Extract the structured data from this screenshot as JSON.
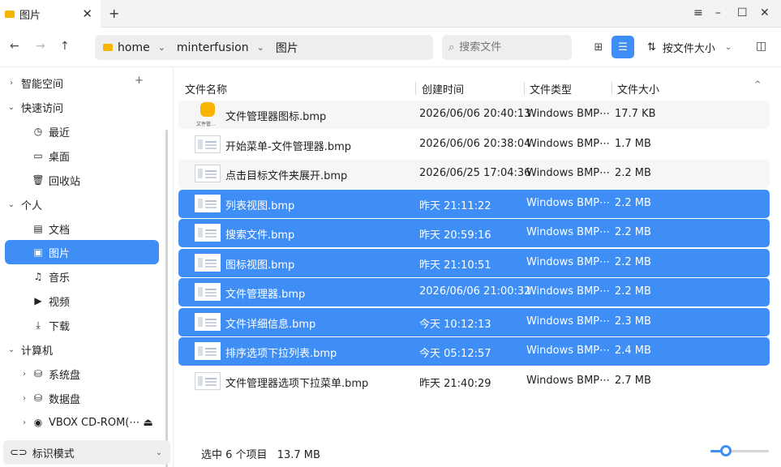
{
  "titlebar": {
    "tab_title": "图片",
    "tab_icon": "folder-image-icon",
    "new_tab": "+",
    "controls": {
      "menu": "≡",
      "minimize": "–",
      "maximize": "☐",
      "close": "✕"
    }
  },
  "toolbar": {
    "back": "←",
    "forward": "→",
    "up": "↑",
    "breadcrumbs": [
      "home",
      "minterfusion",
      "图片"
    ],
    "search_placeholder": "搜索文件",
    "sort_label": "按文件大小",
    "sort_icon": "⇅"
  },
  "sidebar": {
    "plus": "+",
    "items": [
      {
        "label": "智能空间",
        "arrow": "›",
        "icon": ""
      },
      {
        "label": "快速访问",
        "arrow": "⌄",
        "icon": ""
      },
      {
        "label": "最近",
        "arrow": "",
        "icon": "◷"
      },
      {
        "label": "桌面",
        "arrow": "",
        "icon": "▭"
      },
      {
        "label": "回收站",
        "arrow": "",
        "icon": "🗑"
      },
      {
        "label": "个人",
        "arrow": "⌄",
        "icon": ""
      },
      {
        "label": "文档",
        "arrow": "",
        "icon": "▤"
      },
      {
        "label": "图片",
        "arrow": "",
        "icon": "▣"
      },
      {
        "label": "音乐",
        "arrow": "",
        "icon": "♫"
      },
      {
        "label": "视频",
        "arrow": "",
        "icon": "▶"
      },
      {
        "label": "下载",
        "arrow": "",
        "icon": "⤓"
      },
      {
        "label": "计算机",
        "arrow": "⌄",
        "icon": ""
      },
      {
        "label": "系统盘",
        "arrow": "›",
        "icon": "⛁"
      },
      {
        "label": "数据盘",
        "arrow": "›",
        "icon": "⛁"
      },
      {
        "label": "VBOX CD-ROM(⋯ ⏏",
        "arrow": "›",
        "icon": "◉"
      }
    ],
    "mode_label": "标识模式"
  },
  "list": {
    "headers": {
      "name": "文件名称",
      "date": "创建时间",
      "type": "文件类型",
      "size": "文件大小"
    },
    "rows": [
      {
        "name": "文件管理器图标.bmp",
        "date": "2026/06/06 20:40:13",
        "type": "Windows BMP⋯",
        "size": "17.7 KB",
        "thumb": "app",
        "thumb_caption": "文件管...",
        "selected": false
      },
      {
        "name": "开始菜单-文件管理器.bmp",
        "date": "2026/06/06 20:38:04",
        "type": "Windows BMP⋯",
        "size": "1.7 MB",
        "thumb": "img",
        "selected": false
      },
      {
        "name": "点击目标文件夹展开.bmp",
        "date": "2026/06/25 17:04:36",
        "type": "Windows BMP⋯",
        "size": "2.2 MB",
        "thumb": "img",
        "selected": false
      },
      {
        "name": "列表视图.bmp",
        "date": "昨天 21:11:22",
        "type": "Windows BMP⋯",
        "size": "2.2 MB",
        "thumb": "img",
        "selected": true
      },
      {
        "name": "搜索文件.bmp",
        "date": "昨天 20:59:16",
        "type": "Windows BMP⋯",
        "size": "2.2 MB",
        "thumb": "img",
        "selected": true
      },
      {
        "name": "图标视图.bmp",
        "date": "昨天 21:10:51",
        "type": "Windows BMP⋯",
        "size": "2.2 MB",
        "thumb": "img",
        "selected": true
      },
      {
        "name": "文件管理器.bmp",
        "date": "2026/06/06 21:00:32",
        "type": "Windows BMP⋯",
        "size": "2.2 MB",
        "thumb": "img",
        "selected": true
      },
      {
        "name": "文件详细信息.bmp",
        "date": "今天 10:12:13",
        "type": "Windows BMP⋯",
        "size": "2.3 MB",
        "thumb": "img",
        "selected": true
      },
      {
        "name": "排序选项下拉列表.bmp",
        "date": "今天 05:12:57",
        "type": "Windows BMP⋯",
        "size": "2.4 MB",
        "thumb": "img",
        "selected": true
      },
      {
        "name": "文件管理器选项下拉菜单.bmp",
        "date": "昨天 21:40:29",
        "type": "Windows BMP⋯",
        "size": "2.7 MB",
        "thumb": "img",
        "selected": false
      }
    ]
  },
  "status": {
    "selection": "选中 6 个项目",
    "total_size": "13.7 MB",
    "zoom_level": 0.25
  },
  "colors": {
    "accent": "#3f8ef5",
    "folder": "#f5b400"
  }
}
